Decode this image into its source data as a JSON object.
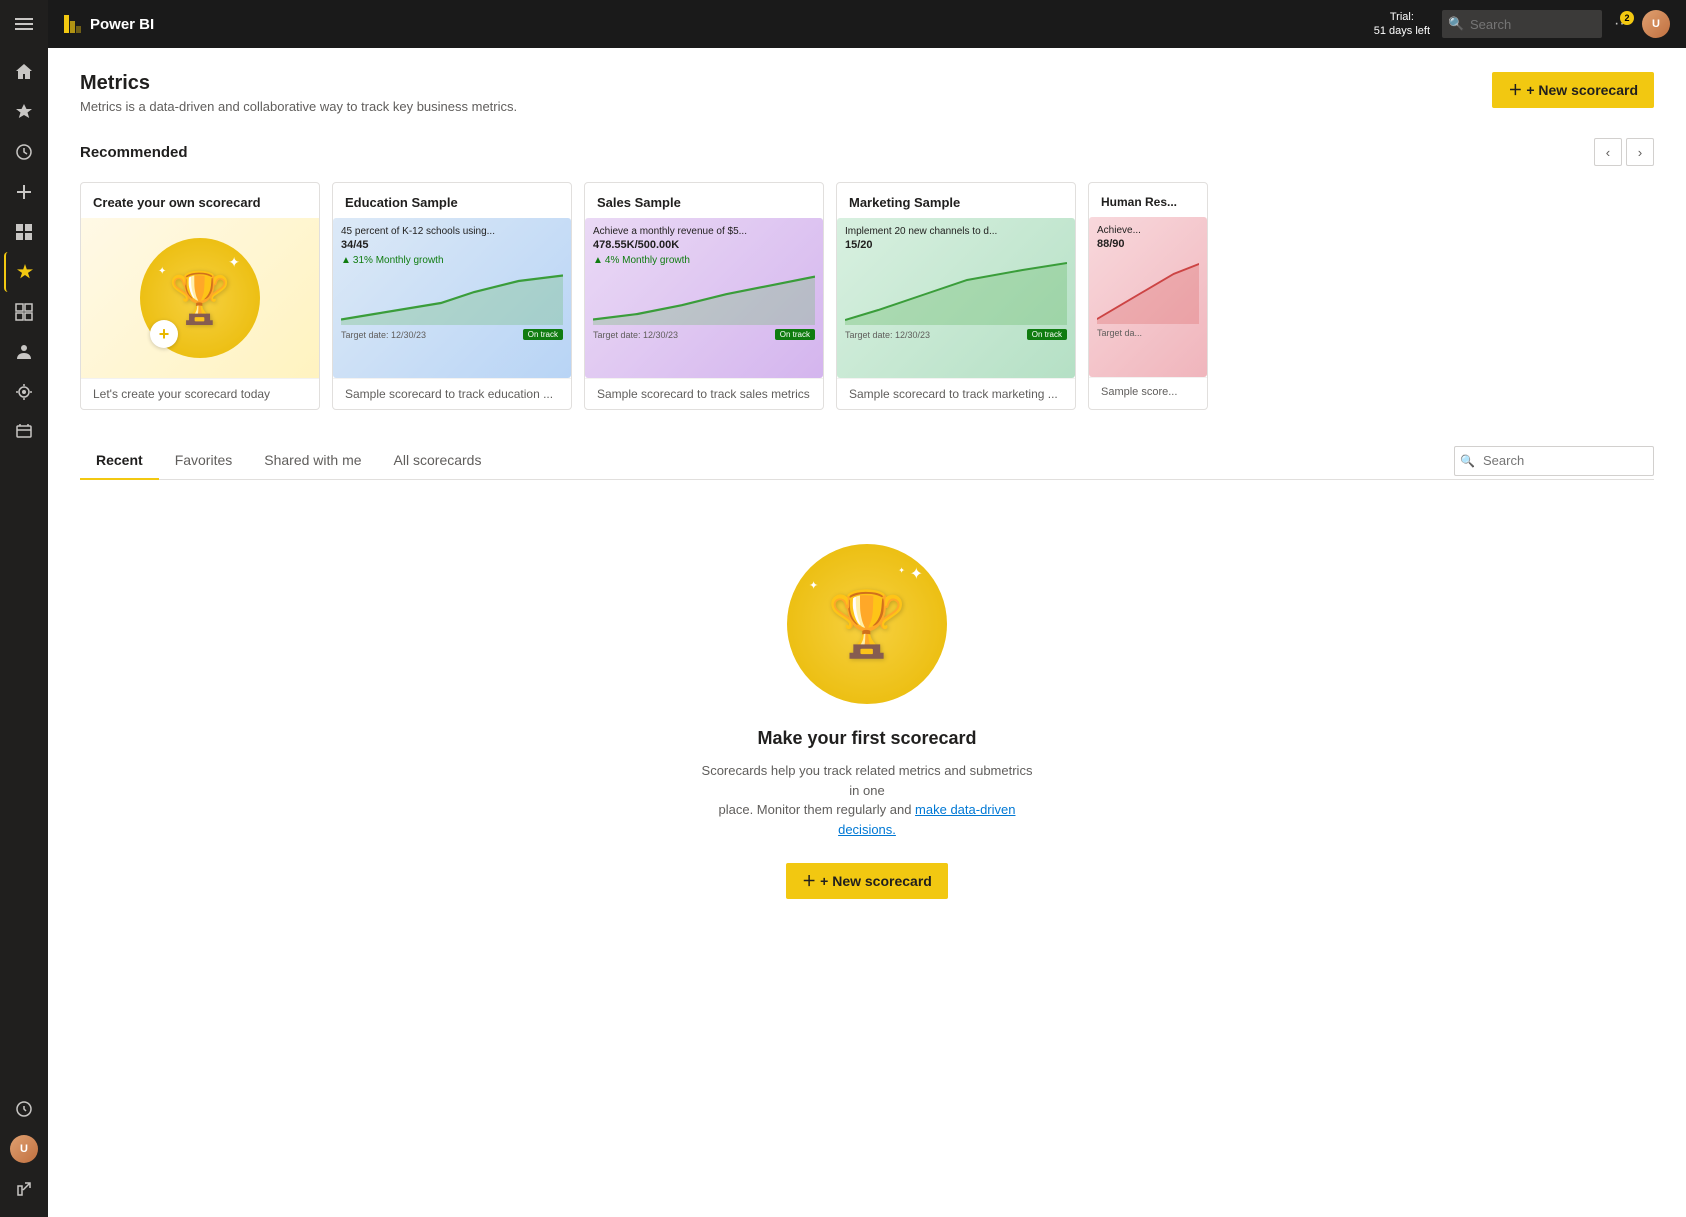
{
  "topbar": {
    "app_name": "Power BI",
    "trial_line1": "Trial:",
    "trial_line2": "51 days left",
    "search_placeholder": "Search",
    "notif_count": "2",
    "avatar_initials": "U"
  },
  "header": {
    "new_scorecard_label": "+ New scorecard"
  },
  "page": {
    "title": "Metrics",
    "subtitle": "Metrics is a data-driven and collaborative way to track key business metrics."
  },
  "recommended": {
    "title": "Recommended",
    "cards": [
      {
        "id": "create",
        "title": "Create your own scorecard",
        "footer": "Let's create your scorecard today",
        "type": "create"
      },
      {
        "id": "education",
        "title": "Education Sample",
        "footer": "Sample scorecard to track education ...",
        "type": "sample",
        "bg": "blue",
        "metric_title": "45 percent of K-12 schools using...",
        "metric_value": "34/45",
        "growth": "31% Monthly growth",
        "target_date": "Target date: 12/30/23",
        "status": "On track"
      },
      {
        "id": "sales",
        "title": "Sales Sample",
        "footer": "Sample scorecard to track sales metrics",
        "type": "sample",
        "bg": "purple",
        "metric_title": "Achieve a monthly revenue of $5...",
        "metric_value": "478.55K/500.00K",
        "growth": "4% Monthly growth",
        "target_date": "Target date: 12/30/23",
        "status": "On track"
      },
      {
        "id": "marketing",
        "title": "Marketing Sample",
        "footer": "Sample scorecard to track marketing ...",
        "type": "sample",
        "bg": "green",
        "metric_title": "Implement 20 new channels to d...",
        "metric_value": "15/20",
        "growth": "",
        "target_date": "Target date: 12/30/23",
        "status": "On track"
      },
      {
        "id": "human",
        "title": "Human Res...",
        "footer": "Sample score...",
        "type": "sample",
        "bg": "pink",
        "metric_title": "Achieve...",
        "metric_value": "88/90",
        "growth": "",
        "target_date": "Target da...",
        "status": ""
      }
    ]
  },
  "tabs": {
    "items": [
      {
        "id": "recent",
        "label": "Recent",
        "active": true
      },
      {
        "id": "favorites",
        "label": "Favorites",
        "active": false
      },
      {
        "id": "shared",
        "label": "Shared with me",
        "active": false
      },
      {
        "id": "all",
        "label": "All scorecards",
        "active": false
      }
    ],
    "search_placeholder": "Search"
  },
  "empty_state": {
    "title": "Make your first scorecard",
    "desc_line1": "Scorecards help you track related metrics and submetrics in one",
    "desc_line2": "place. Monitor them regularly and make data-driven decisions.",
    "cta_label": "+ New scorecard"
  },
  "sidebar": {
    "icons": [
      {
        "id": "menu",
        "symbol": "☰",
        "active": false
      },
      {
        "id": "home",
        "symbol": "⌂",
        "active": false
      },
      {
        "id": "star",
        "symbol": "★",
        "active": false
      },
      {
        "id": "clock",
        "symbol": "◷",
        "active": false
      },
      {
        "id": "plus",
        "symbol": "+",
        "active": false
      },
      {
        "id": "apps",
        "symbol": "⊞",
        "active": false
      },
      {
        "id": "metrics",
        "symbol": "▲",
        "active": true
      },
      {
        "id": "table",
        "symbol": "▦",
        "active": false
      },
      {
        "id": "people",
        "symbol": "♟",
        "active": false
      },
      {
        "id": "rocket",
        "symbol": "🚀",
        "active": false
      },
      {
        "id": "book",
        "symbol": "📖",
        "active": false
      },
      {
        "id": "learn",
        "symbol": "◉",
        "active": false
      },
      {
        "id": "avatar",
        "symbol": "",
        "active": false
      },
      {
        "id": "expand",
        "symbol": "↗",
        "active": false
      }
    ]
  }
}
